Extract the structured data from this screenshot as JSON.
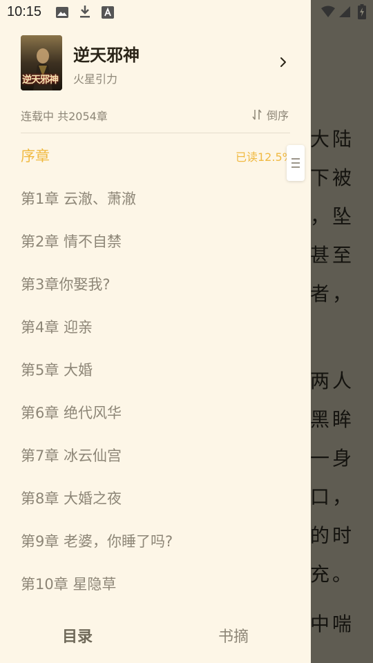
{
  "status_bar": {
    "time": "10:15",
    "icons": [
      "image-icon",
      "download-icon",
      "font-a-icon",
      "wifi-icon",
      "signal-icon",
      "battery-charging-icon"
    ]
  },
  "book": {
    "cover_text": "逆天邪神",
    "title": "逆天邪神",
    "author": "火星引力",
    "status": "连载中 共2054章",
    "sort_label": "倒序"
  },
  "progress": "已读12.5%",
  "chapters": [
    {
      "title": "序章",
      "current": true
    },
    {
      "title": "第1章 云澈、萧澈"
    },
    {
      "title": "第2章 情不自禁"
    },
    {
      "title": "第3章你娶我?"
    },
    {
      "title": "第4章 迎亲"
    },
    {
      "title": "第5章 大婚"
    },
    {
      "title": "第6章 绝代风华"
    },
    {
      "title": "第7章 冰云仙宫"
    },
    {
      "title": "第8章 大婚之夜"
    },
    {
      "title": "第9章 老婆，你睡了吗?"
    },
    {
      "title": "第10章 星隐草"
    }
  ],
  "tabs": [
    {
      "label": "目录",
      "active": true
    },
    {
      "label": "书摘",
      "active": false
    }
  ],
  "reader_fragments": [
    "大陆",
    "下被",
    "，坠",
    "甚至",
    "者，",
    "两人",
    "黑眸",
    "一身",
    "口，",
    "的时",
    "充。",
    "中喘"
  ]
}
